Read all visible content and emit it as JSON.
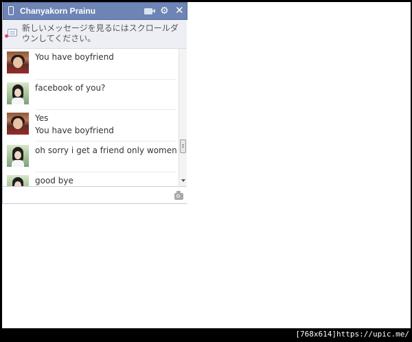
{
  "chat": {
    "title": "Chanyakorn Prainu",
    "notice": "新しいメッセージを見るにはスクロールダウンしてください。",
    "messages": [
      {
        "sender": "other",
        "lines": [
          "You have boyfriend"
        ]
      },
      {
        "sender": "self",
        "lines": [
          "facebook of you?"
        ]
      },
      {
        "sender": "other",
        "lines": [
          "Yes",
          "You have boyfriend"
        ]
      },
      {
        "sender": "self",
        "lines": [
          "oh sorry i get a friend only women"
        ]
      },
      {
        "sender": "self",
        "lines": [
          "good bye"
        ]
      }
    ],
    "compose_placeholder": ""
  },
  "icons": {
    "phone": "phone-icon",
    "video": "video-call-icon",
    "settings": "gear-icon",
    "close": "close-icon",
    "notice": "chat-notice-icon",
    "camera": "camera-icon"
  },
  "colors": {
    "header": "#6d84b4",
    "header_border": "#4c6aa5",
    "notice_bg": "#edeff4",
    "text": "#333333"
  },
  "watermark": "[768x614]https://upic.me/"
}
